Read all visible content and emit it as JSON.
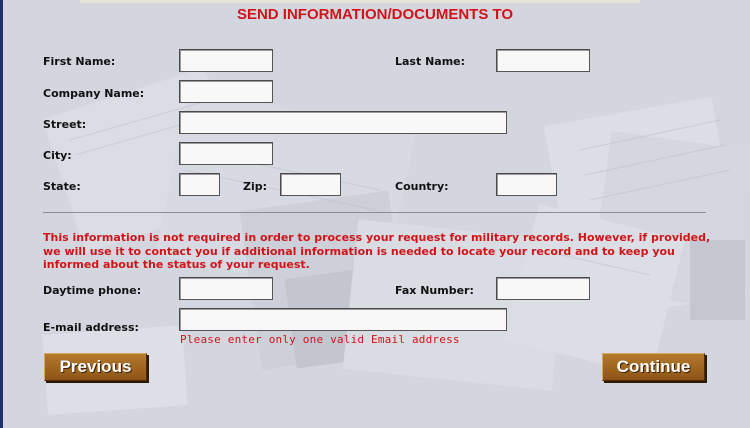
{
  "form": {
    "title": "SEND INFORMATION/DOCUMENTS TO",
    "labels": {
      "first_name": "First Name:",
      "last_name": "Last Name:",
      "company_name": "Company Name:",
      "street": "Street:",
      "city": "City:",
      "state": "State:",
      "zip": "Zip:",
      "country": "Country:",
      "daytime_phone": "Daytime phone:",
      "fax_number": "Fax Number:",
      "email_address": "E-mail address:"
    },
    "values": {
      "first_name": "",
      "last_name": "",
      "company_name": "",
      "street": "",
      "city": "",
      "state": "",
      "zip": "",
      "country": "",
      "daytime_phone": "",
      "fax_number": "",
      "email_address": ""
    },
    "notice": "This information is not required in order to process your request for military records. However, if provided, we will use it to contact you if additional information is needed to locate your record and to keep you informed about the status of your request.",
    "email_hint": "Please enter only one valid Email address",
    "buttons": {
      "previous": "Previous",
      "continue": "Continue"
    }
  }
}
